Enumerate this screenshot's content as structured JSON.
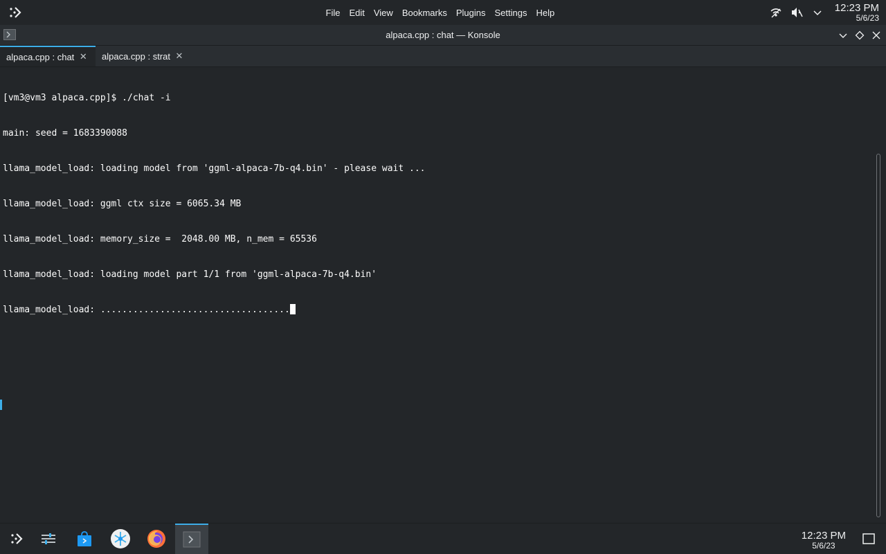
{
  "menubar": {
    "items": [
      "File",
      "Edit",
      "View",
      "Bookmarks",
      "Plugins",
      "Settings",
      "Help"
    ]
  },
  "tray": {
    "time": "12:23 PM",
    "date": "5/6/23"
  },
  "window": {
    "title": "alpaca.cpp : chat — Konsole"
  },
  "tabs": [
    {
      "label": "alpaca.cpp : chat",
      "active": true
    },
    {
      "label": "alpaca.cpp : strat",
      "active": false
    }
  ],
  "terminal": {
    "lines": [
      "[vm3@vm3 alpaca.cpp]$ ./chat -i",
      "main: seed = 1683390088",
      "llama_model_load: loading model from 'ggml-alpaca-7b-q4.bin' - please wait ...",
      "llama_model_load: ggml ctx size = 6065.34 MB",
      "llama_model_load: memory_size =  2048.00 MB, n_mem = 65536",
      "llama_model_load: loading model part 1/1 from 'ggml-alpaca-7b-q4.bin'",
      "llama_model_load: ..................................."
    ]
  },
  "taskbar": {
    "apps": [
      "app-launcher-icon",
      "system-settings-icon",
      "discover-store-icon",
      "app-icon-flake",
      "firefox-icon",
      "konsole-icon"
    ],
    "time": "12:23 PM",
    "date": "5/6/23"
  },
  "colors": {
    "background": "#232629",
    "accent": "#3daee9",
    "text": "#fcfcfc"
  }
}
